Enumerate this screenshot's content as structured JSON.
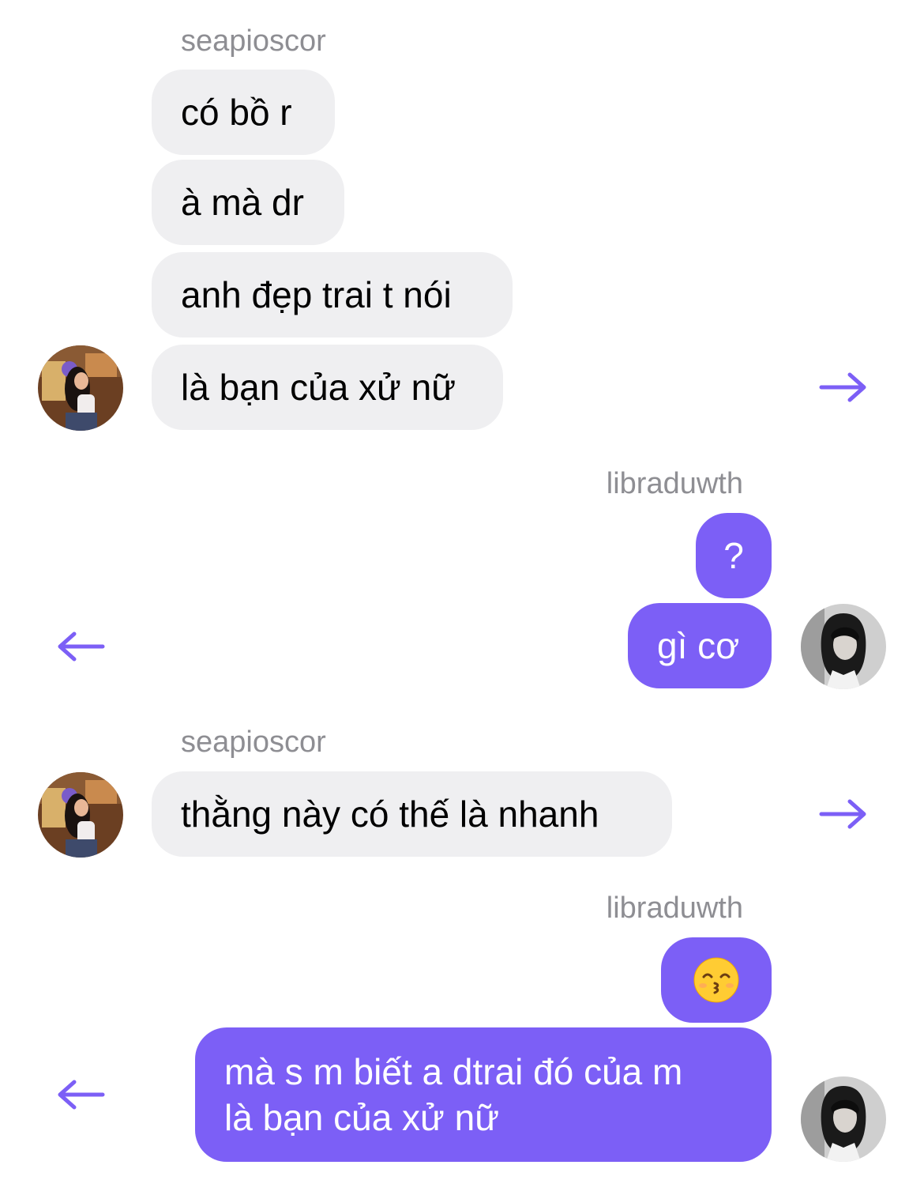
{
  "conversation": {
    "group1": {
      "username": "seapioscor",
      "messages": [
        "có bồ r",
        "à mà dr",
        "anh đẹp trai t nói",
        "là bạn của xử nữ"
      ]
    },
    "group2": {
      "username": "libraduwth",
      "messages": [
        "?",
        "gì cơ"
      ]
    },
    "group3": {
      "username": "seapioscor",
      "messages": [
        "thằng này có thế là nhanh"
      ]
    },
    "group4": {
      "username": "libraduwth",
      "messages": [
        "mà s m biết a dtrai đó của m",
        "là bạn của xử nữ"
      ]
    }
  },
  "icons": {
    "forward": "arrow-right-icon",
    "reply": "arrow-left-icon",
    "emoji": "kissing-face-emoji"
  },
  "colors": {
    "outgoing_bubble": "#7c5ff6",
    "incoming_bubble": "#efeff1",
    "arrow": "#7c5ff6",
    "username": "#8e8e93"
  }
}
